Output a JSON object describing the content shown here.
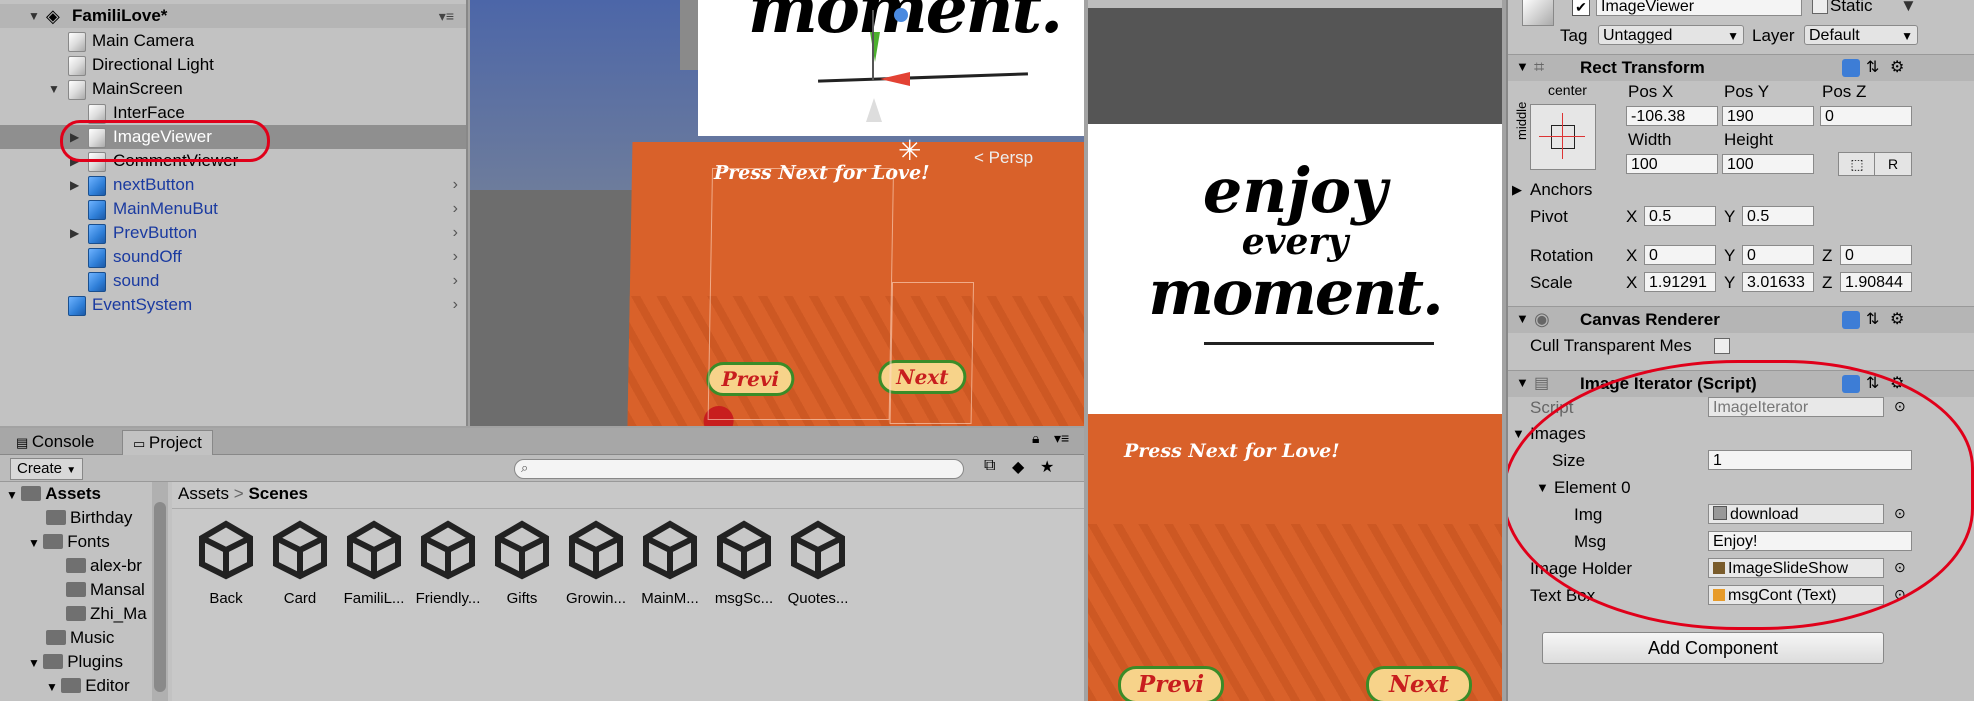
{
  "hierarchy": {
    "scene_name": "FamiliLove*",
    "items": [
      {
        "label": "Main Camera",
        "prefab": false
      },
      {
        "label": "Directional Light",
        "prefab": false
      },
      {
        "label": "MainScreen",
        "prefab": false
      },
      {
        "label": "InterFace",
        "prefab": false
      },
      {
        "label": "ImageViewer",
        "prefab": false
      },
      {
        "label": "CommentViewer",
        "prefab": false
      },
      {
        "label": "nextButton",
        "prefab": true
      },
      {
        "label": "MainMenuBut",
        "prefab": true
      },
      {
        "label": "PrevButton",
        "prefab": true
      },
      {
        "label": "soundOff",
        "prefab": true
      },
      {
        "label": "sound",
        "prefab": true
      },
      {
        "label": "EventSystem",
        "prefab": true
      }
    ],
    "selected": "ImageViewer"
  },
  "scene_view": {
    "persp_label": "< Persp",
    "banner_text": "Press Next for Love!",
    "prev_label": "Previ",
    "next_label": "Next",
    "moment_text": "moment."
  },
  "game_view": {
    "enjoy_line1": "enjoy",
    "enjoy_line2": "every",
    "enjoy_line3": "moment.",
    "banner_text": "Press Next for Love!",
    "prev_label": "Previ",
    "next_label": "Next"
  },
  "inspector": {
    "object_name": "ImageViewer",
    "static_label": "Static",
    "tag_label": "Tag",
    "tag_value": "Untagged",
    "layer_label": "Layer",
    "layer_value": "Default",
    "rect_transform": {
      "title": "Rect Transform",
      "anchor_h": "center",
      "anchor_v": "middle",
      "posx_label": "Pos X",
      "posx": "-106.38",
      "posy_label": "Pos Y",
      "posy": "190",
      "posz_label": "Pos Z",
      "posz": "0",
      "width_label": "Width",
      "width": "100",
      "height_label": "Height",
      "height": "100",
      "r_button": "R",
      "anchors_label": "Anchors",
      "pivot_label": "Pivot",
      "pivot_x": "0.5",
      "pivot_y": "0.5",
      "rotation_label": "Rotation",
      "rot_x": "0",
      "rot_y": "0",
      "rot_z": "0",
      "scale_label": "Scale",
      "scale_x": "1.91291",
      "scale_y": "3.01633",
      "scale_z": "1.90844",
      "x": "X",
      "y": "Y",
      "z": "Z"
    },
    "canvas_renderer": {
      "title": "Canvas Renderer",
      "cull_label": "Cull Transparent Mes"
    },
    "image_iterator": {
      "title": "Image Iterator (Script)",
      "script_label": "Script",
      "script_value": "ImageIterator",
      "images_label": "Images",
      "size_label": "Size",
      "size_value": "1",
      "element_label": "Element 0",
      "img_label": "Img",
      "img_value": "download",
      "msg_label": "Msg",
      "msg_value": "Enjoy!",
      "holder_label": "Image Holder",
      "holder_value": "ImageSlideShow",
      "textbox_label": "Text Box",
      "textbox_value": "msgCont (Text)"
    },
    "add_component": "Add Component"
  },
  "project": {
    "console_tab": "Console",
    "project_tab": "Project",
    "create_label": "Create",
    "search_placeholder": "",
    "breadcrumb_root": "Assets",
    "breadcrumb_sep": ">",
    "breadcrumb_current": "Scenes",
    "tree": [
      {
        "label": "Assets",
        "bold": true
      },
      {
        "label": "Birthday",
        "bold": false
      },
      {
        "label": "Fonts",
        "bold": false
      },
      {
        "label": "alex-br",
        "bold": false
      },
      {
        "label": "Mansal",
        "bold": false
      },
      {
        "label": "Zhi_Ma",
        "bold": false
      },
      {
        "label": "Music",
        "bold": false
      },
      {
        "label": "Plugins",
        "bold": false
      },
      {
        "label": "Editor",
        "bold": false
      }
    ],
    "assets": [
      "Back",
      "Card",
      "FamiliL...",
      "Friendly...",
      "Gifts",
      "Growin...",
      "MainM...",
      "msgSc...",
      "Quotes..."
    ]
  },
  "colors": {
    "orange": "#d9612a",
    "highlight_circle": "#e0001a",
    "prefab_blue": "#1a3aa0"
  }
}
